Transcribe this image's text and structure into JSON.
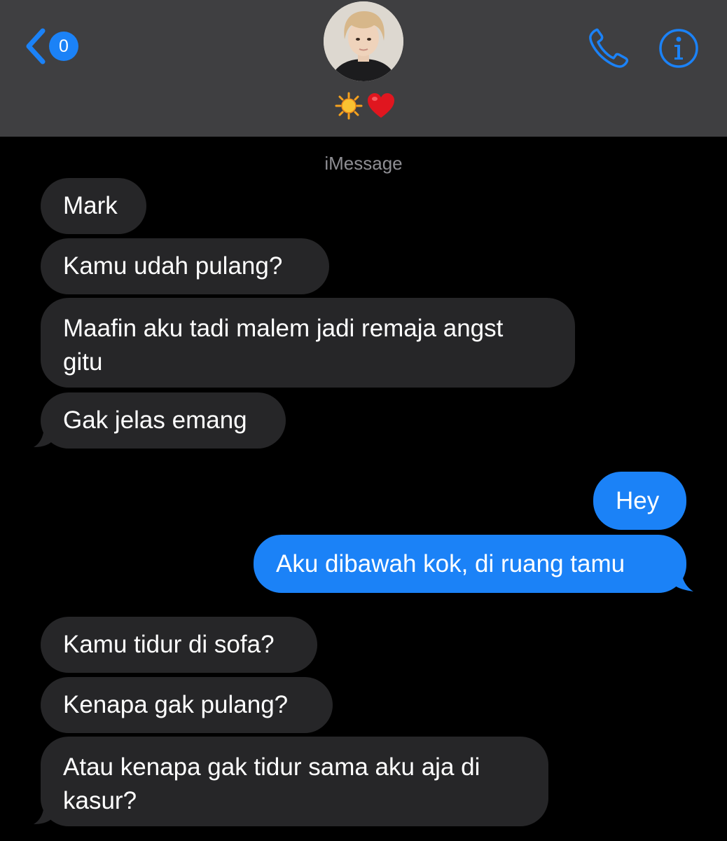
{
  "header": {
    "back_badge_count": "0",
    "status_emojis": [
      "sun",
      "heart"
    ],
    "icons": {
      "back": "chevron-left-icon",
      "call": "phone-icon",
      "info": "info-icon"
    },
    "accent_color": "#1b82f7",
    "background_color": "#3f3f41"
  },
  "conversation": {
    "service_label": "iMessage",
    "messages": [
      {
        "sender": "them",
        "lines": [
          "Mark"
        ]
      },
      {
        "sender": "them",
        "lines": [
          "Kamu udah pulang?"
        ]
      },
      {
        "sender": "them",
        "lines": [
          "Maafin aku tadi malem jadi remaja angst",
          "gitu"
        ]
      },
      {
        "sender": "them",
        "lines": [
          "Gak jelas emang"
        ]
      },
      {
        "sender": "me",
        "lines": [
          "Hey"
        ]
      },
      {
        "sender": "me",
        "lines": [
          "Aku dibawah kok, di ruang tamu"
        ]
      },
      {
        "sender": "them",
        "lines": [
          "Kamu tidur di sofa?"
        ]
      },
      {
        "sender": "them",
        "lines": [
          "Kenapa gak pulang?"
        ]
      },
      {
        "sender": "them",
        "lines": [
          "Atau kenapa gak tidur sama aku aja di",
          "kasur?"
        ]
      }
    ],
    "incoming_bubble_color": "#262628",
    "outgoing_bubble_color": "#1b82f7"
  }
}
